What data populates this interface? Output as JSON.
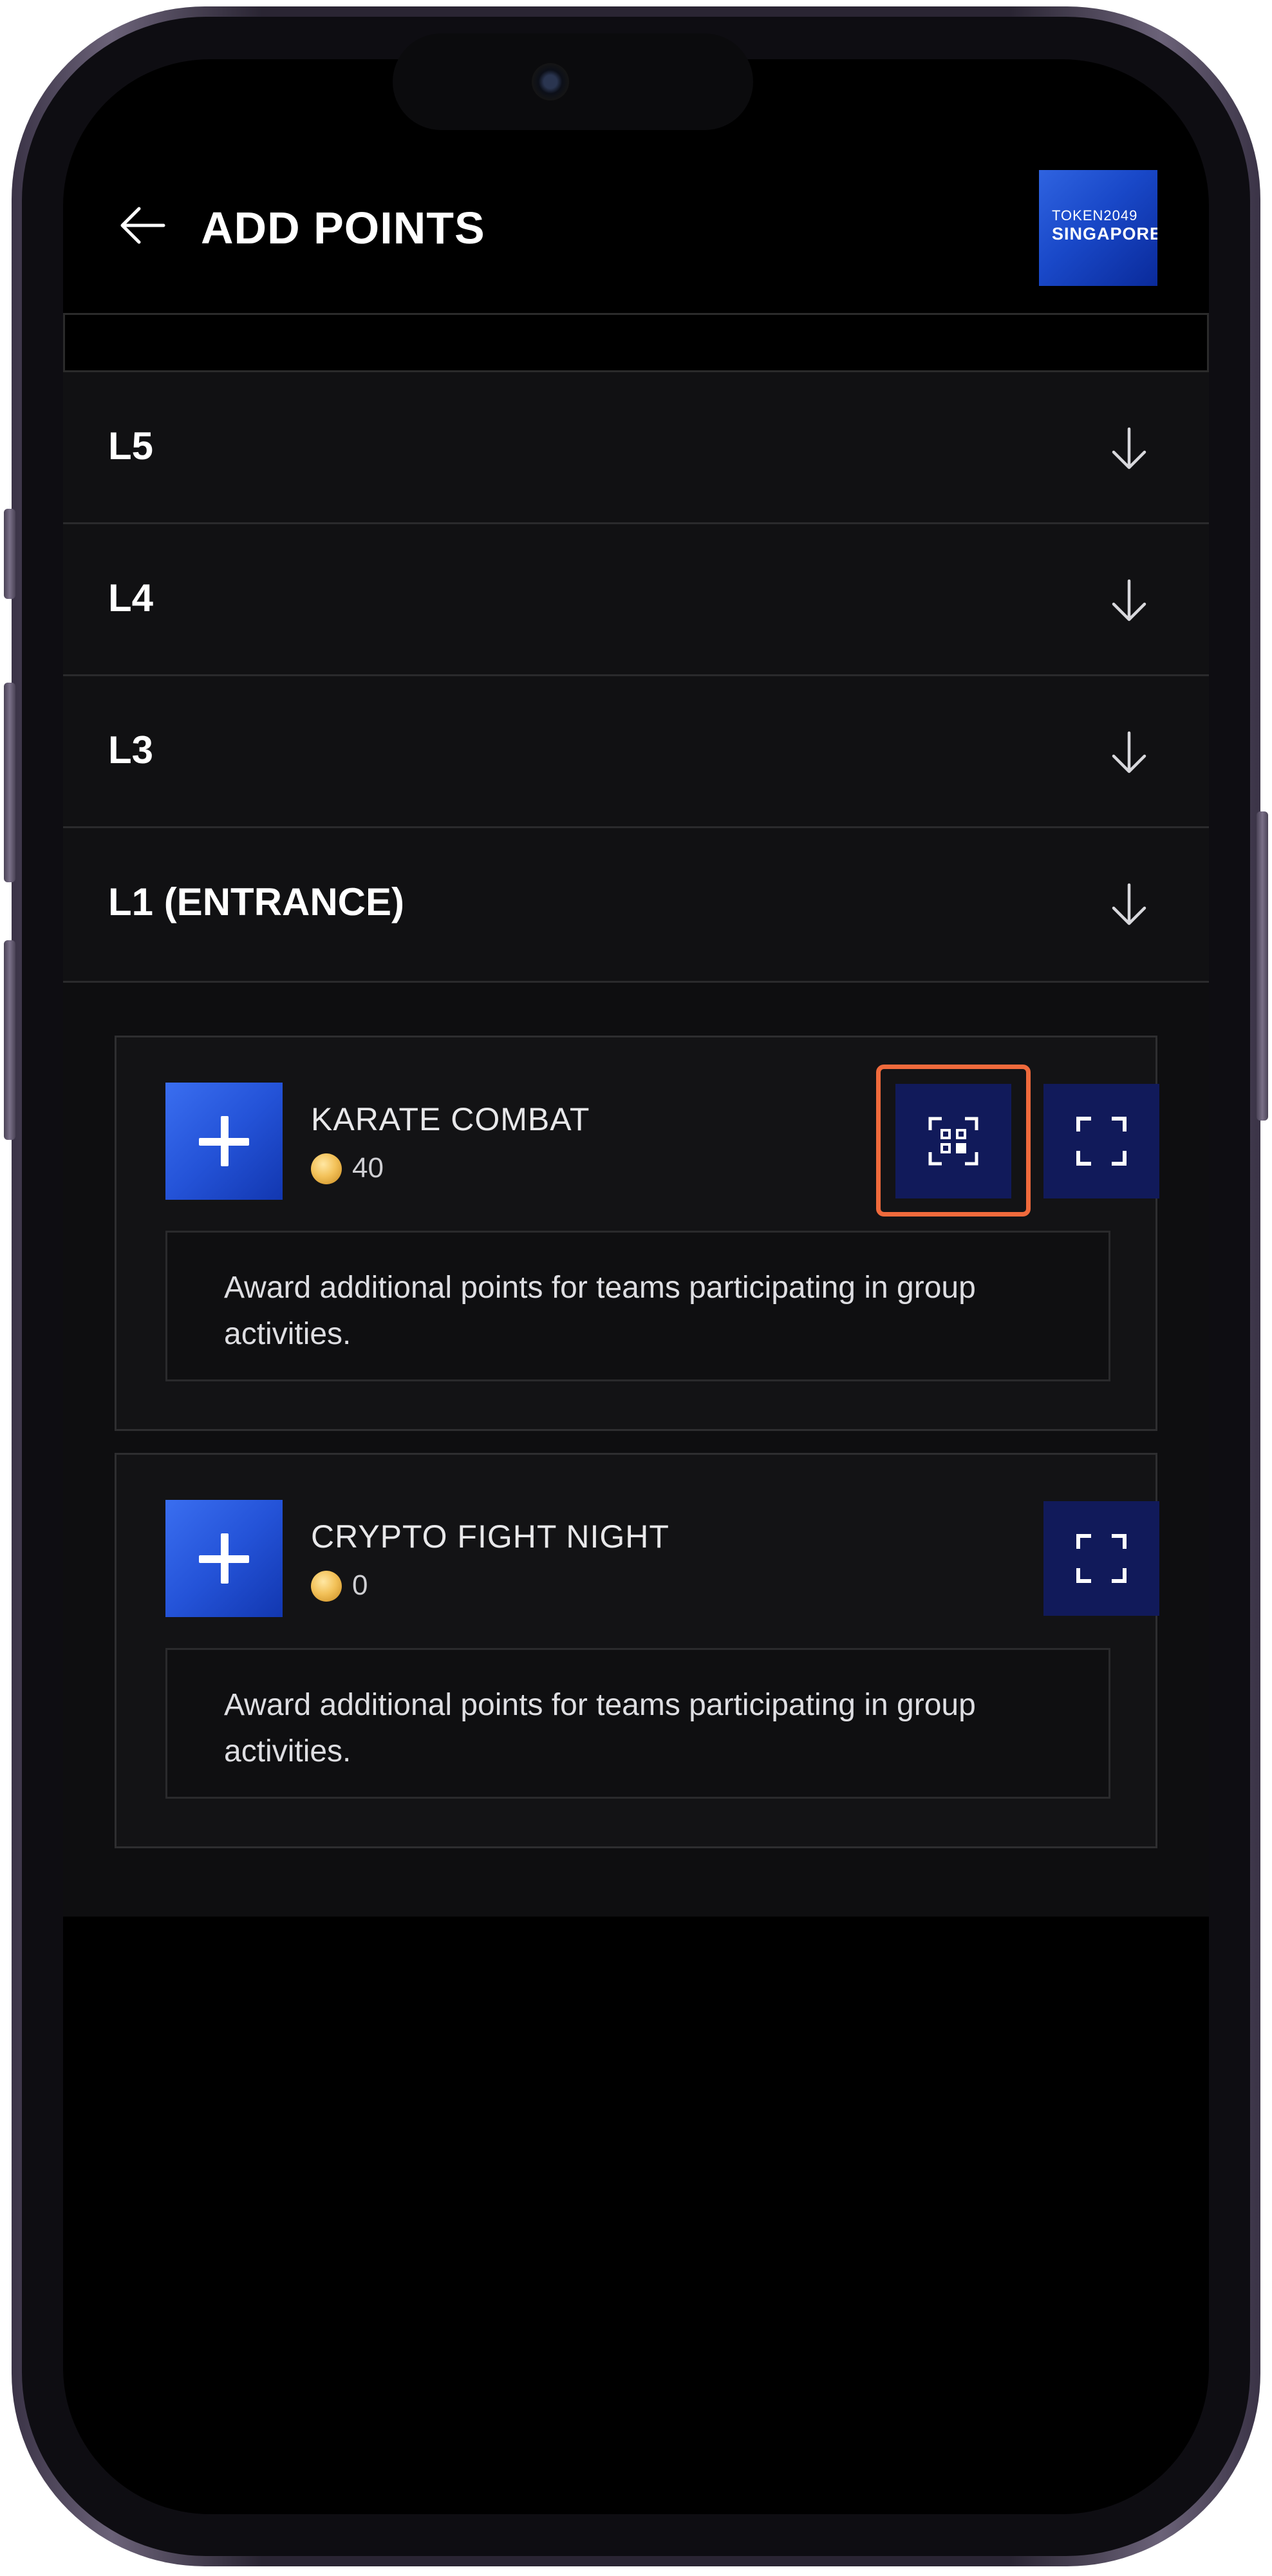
{
  "header": {
    "title": "ADD POINTS",
    "back_icon": "arrow-left-icon",
    "event_logo": {
      "line1": "TOKEN2049",
      "line2": "SINGAPORE",
      "line3": ""
    }
  },
  "sections": [
    {
      "label": "L5",
      "icon": "arrow-down-icon",
      "expanded": false
    },
    {
      "label": "L4",
      "icon": "arrow-down-icon",
      "expanded": false
    },
    {
      "label": "L3",
      "icon": "arrow-down-icon",
      "expanded": false
    },
    {
      "label": "L1 (ENTRANCE)",
      "icon": "arrow-down-icon",
      "expanded": true
    }
  ],
  "activities": [
    {
      "name": "KARATE COMBAT",
      "points": "40",
      "description": "Award additional points for teams participating in group activities.",
      "actions": [
        "add-icon",
        "qr-scan-icon",
        "scan-frame-icon"
      ],
      "highlighted_action": "qr-scan-icon"
    },
    {
      "name": "CRYPTO FIGHT NIGHT",
      "points": "0",
      "description": "Award additional points for teams participating in group activities.",
      "actions": [
        "add-icon",
        "scan-frame-icon"
      ]
    }
  ],
  "colors": {
    "background": "#000000",
    "accent_blue": "#2453d8",
    "button_navy": "#111a5a",
    "highlight": "#f06a3c",
    "coin_gold": "#f3c25a"
  }
}
